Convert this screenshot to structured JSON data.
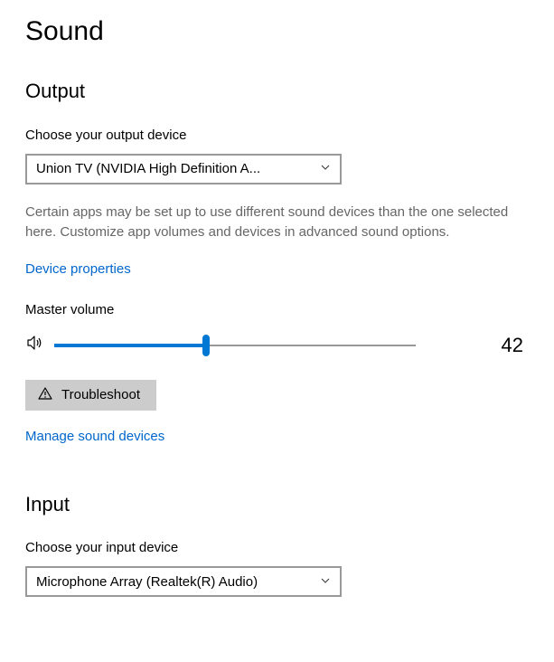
{
  "page_title": "Sound",
  "output": {
    "section_title": "Output",
    "choose_label": "Choose your output device",
    "selected_device": "Union TV (NVIDIA High Definition A...",
    "description": "Certain apps may be set up to use different sound devices than the one selected here. Customize app volumes and devices in advanced sound options.",
    "device_properties_link": "Device properties",
    "master_volume_label": "Master volume",
    "master_volume_value": 42,
    "troubleshoot_label": "Troubleshoot",
    "manage_devices_link": "Manage sound devices"
  },
  "input": {
    "section_title": "Input",
    "choose_label": "Choose your input device",
    "selected_device": "Microphone Array (Realtek(R) Audio)"
  }
}
